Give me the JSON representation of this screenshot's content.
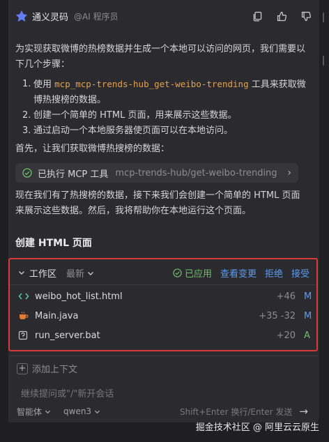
{
  "header": {
    "brand": "通义灵码",
    "subtitle": "@AI 程序员",
    "icons": [
      "copy-icon",
      "thumbs-up-icon",
      "thumbs-down-icon"
    ]
  },
  "message": {
    "intro": "为实现获取微博的热榜数据并生成一个本地可以访问的网页，我们需要以下几个步骤：",
    "steps": [
      {
        "num": "1.",
        "pre": "使用 ",
        "code": "mcp_mcp-trends-hub_get-weibo-trending",
        "post": " 工具来获取微博热搜榜的数据。"
      },
      {
        "num": "2.",
        "text": "创建一个简单的 HTML 页面，用来展示这些数据。"
      },
      {
        "num": "3.",
        "text": "通过启动一个本地服务器使页面可以在本地访问。"
      }
    ],
    "first": "首先，让我们获取微博热搜榜的数据：",
    "tool_call": {
      "label": "已执行 MCP 工具",
      "path": "mcp-trends-hub/get-weibo-trending"
    },
    "after": "现在我们有了热搜榜的数据，接下来我们会创建一个简单的 HTML 页面来展示这些数据。然后，我将帮助你在本地运行这个页面。",
    "heading": "创建 HTML 页面"
  },
  "workspace": {
    "title": "工作区",
    "sort": "最新",
    "applied": "已应用",
    "view_changes": "查看变更",
    "reject": "拒绝",
    "accept": "接受",
    "files": [
      {
        "name": "weibo_hot_list.html",
        "stat": "+46",
        "status": "M",
        "icon": "html-code-icon"
      },
      {
        "name": "Main.java",
        "stat": "+35 -32",
        "status": "M",
        "icon": "java-cup-icon"
      },
      {
        "name": "run_server.bat",
        "stat": "+20",
        "status": "A",
        "icon": "bat-file-icon"
      }
    ]
  },
  "input": {
    "add_context": "添加上下文",
    "placeholder": "继续提问或\"/\"新开会话",
    "mode": "智能体",
    "model": "qwen3",
    "hint": "Shift+Enter 换行/Enter 发送"
  },
  "watermark": "掘金技术社区 @ 阿里云云原生",
  "colors": {
    "accent": "#5b9cf0",
    "success": "#6bbf6a",
    "code": "#e3a24f",
    "highlight_border": "#d83a3a"
  }
}
